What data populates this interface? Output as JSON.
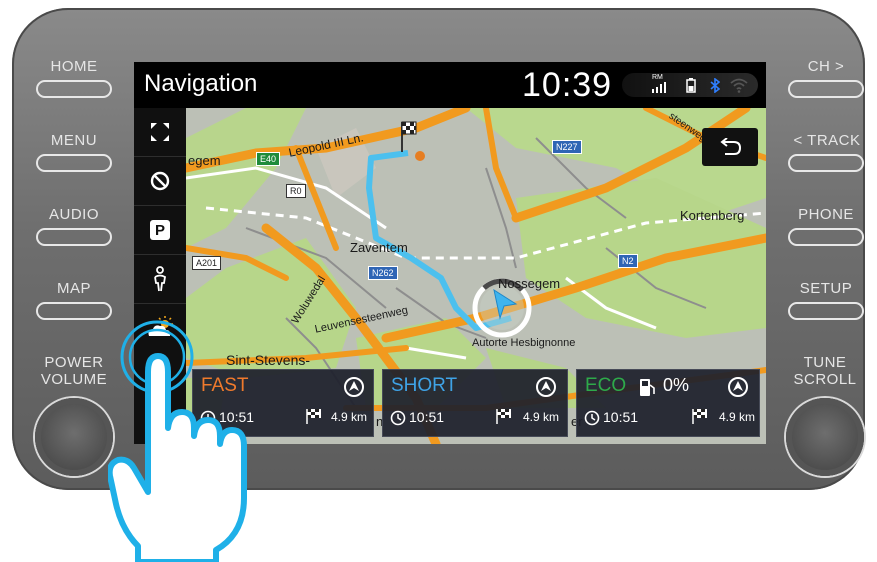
{
  "hardware": {
    "left_buttons": [
      "HOME",
      "MENU",
      "AUDIO",
      "MAP"
    ],
    "right_buttons": [
      "CH >",
      "< TRACK",
      "PHONE",
      "SETUP"
    ],
    "left_knob_label_1": "POWER",
    "left_knob_label_2": "VOLUME",
    "right_knob_label_1": "TUNE",
    "right_knob_label_2": "SCROLL"
  },
  "status_bar": {
    "title": "Navigation",
    "time": "10:39",
    "signal_tag": "RM",
    "icons": [
      "signal-icon",
      "battery-icon",
      "bluetooth-icon",
      "wifi-icon"
    ]
  },
  "sidebar": {
    "items": [
      "fullscreen-icon",
      "avoid-icon",
      "parking-icon",
      "pedestrian-icon",
      "weather-icon"
    ],
    "parking_label": "P"
  },
  "map": {
    "places": {
      "gem": "egem",
      "leopold": "Leopold III Ln.",
      "zaventem": "Zaventem",
      "nossegem": "Nossegem",
      "kortenberg": "Kortenberg",
      "woluwedal": "Woluwedal",
      "leuvensesteenweg": "Leuvensesteenweg",
      "autorte": "Autorte Hesbignonne",
      "sint_stevens": "Sint-Stevens-",
      "steenweg": "steenweg",
      "partial_n": "n",
      "partial_er": "er"
    },
    "shields": {
      "e40": "E40",
      "r0": "R0",
      "a201": "A201",
      "n262": "N262",
      "n227": "N227",
      "n2": "N2"
    }
  },
  "routes": [
    {
      "name": "FAST",
      "color": "#f07a2c",
      "eta": "10:51",
      "distance": "4.9 km",
      "extra": ""
    },
    {
      "name": "SHORT",
      "color": "#3fa3e6",
      "eta": "10:51",
      "distance": "4.9 km",
      "extra": ""
    },
    {
      "name": "ECO",
      "color": "#2eaa4a",
      "eta": "10:51",
      "distance": "4.9 km",
      "extra": "0%"
    }
  ]
}
